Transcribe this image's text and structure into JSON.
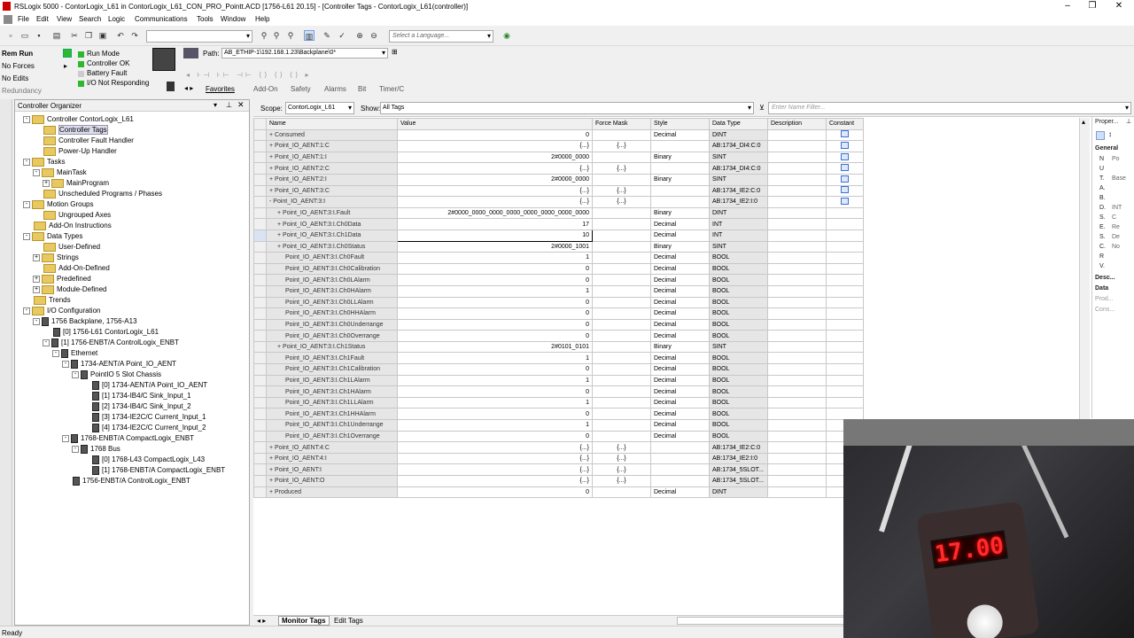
{
  "window": {
    "title": "RSLogix 5000 - ContorLogix_L61 in ContorLogix_L61_CON_PRO_Pointt.ACD [1756-L61 20.15] - [Controller Tags - ContorLogix_L61(controller)]",
    "minimize": "–",
    "restore": "❐",
    "close": "✕"
  },
  "menu": [
    "File",
    "Edit",
    "View",
    "Search",
    "Logic",
    "Communications",
    "Tools",
    "Window",
    "Help"
  ],
  "toolbar": {
    "language_placeholder": "Select a Language...",
    "path_label": "Path:",
    "path_value": "AB_ETHIP-1\\192.168.1.23\\Backplane\\0*"
  },
  "status": {
    "mode": "Rem Run",
    "forces": "No Forces",
    "edits": "No Edits",
    "redundancy": "Redundancy",
    "run_mode": "Run Mode",
    "controller_ok": "Controller OK",
    "battery_fault": "Battery Fault",
    "io_status": "I/O Not Responding"
  },
  "instr_tabs": [
    "Favorites",
    "Add-On",
    "Safety",
    "Alarms",
    "Bit",
    "Timer/C"
  ],
  "organizer": {
    "title": "Controller Organizer",
    "items": [
      {
        "label": "Controller ContorLogix_L61",
        "indent": 1,
        "icon": "folder",
        "exp": "-"
      },
      {
        "label": "Controller Tags",
        "indent": 2,
        "icon": "folder",
        "exp": ""
      },
      {
        "label": "Controller Fault Handler",
        "indent": 2,
        "icon": "folder",
        "exp": ""
      },
      {
        "label": "Power-Up Handler",
        "indent": 2,
        "icon": "folder",
        "exp": ""
      },
      {
        "label": "Tasks",
        "indent": 1,
        "icon": "folder",
        "exp": "-"
      },
      {
        "label": "MainTask",
        "indent": 2,
        "icon": "folder",
        "exp": "-"
      },
      {
        "label": "MainProgram",
        "indent": 3,
        "icon": "folder",
        "exp": "+"
      },
      {
        "label": "Unscheduled Programs / Phases",
        "indent": 2,
        "icon": "folder",
        "exp": ""
      },
      {
        "label": "Motion Groups",
        "indent": 1,
        "icon": "folder",
        "exp": "-"
      },
      {
        "label": "Ungrouped Axes",
        "indent": 2,
        "icon": "folder",
        "exp": ""
      },
      {
        "label": "Add-On Instructions",
        "indent": 1,
        "icon": "folder",
        "exp": ""
      },
      {
        "label": "Data Types",
        "indent": 1,
        "icon": "folder",
        "exp": "-"
      },
      {
        "label": "User-Defined",
        "indent": 2,
        "icon": "folder",
        "exp": ""
      },
      {
        "label": "Strings",
        "indent": 2,
        "icon": "folder",
        "exp": "+"
      },
      {
        "label": "Add-On-Defined",
        "indent": 2,
        "icon": "folder",
        "exp": ""
      },
      {
        "label": "Predefined",
        "indent": 2,
        "icon": "folder",
        "exp": "+"
      },
      {
        "label": "Module-Defined",
        "indent": 2,
        "icon": "folder",
        "exp": "+"
      },
      {
        "label": "Trends",
        "indent": 1,
        "icon": "folder",
        "exp": ""
      },
      {
        "label": "I/O Configuration",
        "indent": 1,
        "icon": "folder",
        "exp": "-"
      },
      {
        "label": "1756 Backplane, 1756-A13",
        "indent": 2,
        "icon": "dev",
        "exp": "-"
      },
      {
        "label": "[0] 1756-L61 ContorLogix_L61",
        "indent": 3,
        "icon": "dev",
        "exp": ""
      },
      {
        "label": "[1] 1756-ENBT/A ControlLogix_ENBT",
        "indent": 3,
        "icon": "dev",
        "exp": "-"
      },
      {
        "label": "Ethernet",
        "indent": 4,
        "icon": "dev",
        "exp": "-"
      },
      {
        "label": "1734-AENT/A Point_IO_AENT",
        "indent": 5,
        "icon": "dev",
        "exp": "-"
      },
      {
        "label": "PointIO 5 Slot Chassis",
        "indent": 6,
        "icon": "dev",
        "exp": "-"
      },
      {
        "label": "[0] 1734-AENT/A Point_IO_AENT",
        "indent": 7,
        "icon": "dev",
        "exp": ""
      },
      {
        "label": "[1] 1734-IB4/C Sink_Input_1",
        "indent": 7,
        "icon": "dev",
        "exp": ""
      },
      {
        "label": "[2] 1734-IB4/C Sink_Input_2",
        "indent": 7,
        "icon": "dev",
        "exp": ""
      },
      {
        "label": "[3] 1734-IE2C/C Current_Input_1",
        "indent": 7,
        "icon": "dev",
        "exp": ""
      },
      {
        "label": "[4] 1734-IE2C/C Current_Input_2",
        "indent": 7,
        "icon": "dev",
        "exp": ""
      },
      {
        "label": "1768-ENBT/A CompactLogix_ENBT",
        "indent": 5,
        "icon": "dev",
        "exp": "-"
      },
      {
        "label": "1768 Bus",
        "indent": 6,
        "icon": "dev",
        "exp": "-"
      },
      {
        "label": "[0] 1768-L43 CompactLogix_L43",
        "indent": 7,
        "icon": "dev",
        "exp": ""
      },
      {
        "label": "[1] 1768-ENBT/A CompactLogix_ENBT",
        "indent": 7,
        "icon": "dev",
        "exp": ""
      },
      {
        "label": "1756-ENBT/A ControlLogix_ENBT",
        "indent": 5,
        "icon": "dev",
        "exp": ""
      }
    ]
  },
  "scope": {
    "scope_label": "Scope:",
    "scope_value": "ContorLogix_L61",
    "show_label": "Show:",
    "show_value": "All Tags",
    "filter_placeholder": "Enter Name Filter..."
  },
  "columns": [
    "Name",
    "Value",
    "Force Mask",
    "Style",
    "Data Type",
    "Description",
    "Constant"
  ],
  "rows": [
    {
      "name": "Consumed",
      "exp": "+",
      "lvl": 0,
      "value": "0",
      "fm": "",
      "style": "Decimal",
      "dt": "DINT",
      "const": true
    },
    {
      "name": "Point_IO_AENT:1:C",
      "exp": "+",
      "lvl": 0,
      "value": "{...}",
      "fm": "{...}",
      "style": "",
      "dt": "AB:1734_DI4:C:0",
      "const": true
    },
    {
      "name": "Point_IO_AENT:1:I",
      "exp": "+",
      "lvl": 0,
      "value": "2#0000_0000",
      "fm": "",
      "style": "Binary",
      "dt": "SINT",
      "const": true
    },
    {
      "name": "Point_IO_AENT:2:C",
      "exp": "+",
      "lvl": 0,
      "value": "{...}",
      "fm": "{...}",
      "style": "",
      "dt": "AB:1734_DI4:C:0",
      "const": true
    },
    {
      "name": "Point_IO_AENT:2:I",
      "exp": "+",
      "lvl": 0,
      "value": "2#0000_0000",
      "fm": "",
      "style": "Binary",
      "dt": "SINT",
      "const": true
    },
    {
      "name": "Point_IO_AENT:3:C",
      "exp": "+",
      "lvl": 0,
      "value": "{...}",
      "fm": "{...}",
      "style": "",
      "dt": "AB:1734_IE2:C:0",
      "const": true
    },
    {
      "name": "Point_IO_AENT:3:I",
      "exp": "-",
      "lvl": 0,
      "value": "{...}",
      "fm": "{...}",
      "style": "",
      "dt": "AB:1734_IE2:I:0",
      "const": true
    },
    {
      "name": "Point_IO_AENT:3:I.Fault",
      "exp": "+",
      "lvl": 1,
      "value": "2#0000_0000_0000_0000_0000_0000_0000_0000",
      "fm": "",
      "style": "Binary",
      "dt": "DINT",
      "const": false
    },
    {
      "name": "Point_IO_AENT:3:I.Ch0Data",
      "exp": "+",
      "lvl": 1,
      "value": "17",
      "fm": "",
      "style": "Decimal",
      "dt": "INT",
      "const": false
    },
    {
      "name": "Point_IO_AENT:3:I.Ch1Data",
      "exp": "+",
      "lvl": 1,
      "value": "10",
      "fm": "",
      "style": "Decimal",
      "dt": "INT",
      "const": false
    },
    {
      "name": "Point_IO_AENT:3:I.Ch0Status",
      "exp": "+",
      "lvl": 1,
      "value": "2#0000_1001",
      "fm": "",
      "style": "Binary",
      "dt": "SINT",
      "const": false
    },
    {
      "name": "Point_IO_AENT:3:I.Ch0Fault",
      "exp": "",
      "lvl": 2,
      "value": "1",
      "fm": "",
      "style": "Decimal",
      "dt": "BOOL",
      "const": false
    },
    {
      "name": "Point_IO_AENT:3:I.Ch0Calibration",
      "exp": "",
      "lvl": 2,
      "value": "0",
      "fm": "",
      "style": "Decimal",
      "dt": "BOOL",
      "const": false
    },
    {
      "name": "Point_IO_AENT:3:I.Ch0LAlarm",
      "exp": "",
      "lvl": 2,
      "value": "0",
      "fm": "",
      "style": "Decimal",
      "dt": "BOOL",
      "const": false
    },
    {
      "name": "Point_IO_AENT:3:I.Ch0HAlarm",
      "exp": "",
      "lvl": 2,
      "value": "1",
      "fm": "",
      "style": "Decimal",
      "dt": "BOOL",
      "const": false
    },
    {
      "name": "Point_IO_AENT:3:I.Ch0LLAlarm",
      "exp": "",
      "lvl": 2,
      "value": "0",
      "fm": "",
      "style": "Decimal",
      "dt": "BOOL",
      "const": false
    },
    {
      "name": "Point_IO_AENT:3:I.Ch0HHAlarm",
      "exp": "",
      "lvl": 2,
      "value": "0",
      "fm": "",
      "style": "Decimal",
      "dt": "BOOL",
      "const": false
    },
    {
      "name": "Point_IO_AENT:3:I.Ch0Underrange",
      "exp": "",
      "lvl": 2,
      "value": "0",
      "fm": "",
      "style": "Decimal",
      "dt": "BOOL",
      "const": false
    },
    {
      "name": "Point_IO_AENT:3:I.Ch0Overrange",
      "exp": "",
      "lvl": 2,
      "value": "0",
      "fm": "",
      "style": "Decimal",
      "dt": "BOOL",
      "const": false
    },
    {
      "name": "Point_IO_AENT:3:I.Ch1Status",
      "exp": "+",
      "lvl": 1,
      "value": "2#0101_0101",
      "fm": "",
      "style": "Binary",
      "dt": "SINT",
      "const": false
    },
    {
      "name": "Point_IO_AENT:3:I.Ch1Fault",
      "exp": "",
      "lvl": 2,
      "value": "1",
      "fm": "",
      "style": "Decimal",
      "dt": "BOOL",
      "const": false
    },
    {
      "name": "Point_IO_AENT:3:I.Ch1Calibration",
      "exp": "",
      "lvl": 2,
      "value": "0",
      "fm": "",
      "style": "Decimal",
      "dt": "BOOL",
      "const": false
    },
    {
      "name": "Point_IO_AENT:3:I.Ch1LAlarm",
      "exp": "",
      "lvl": 2,
      "value": "1",
      "fm": "",
      "style": "Decimal",
      "dt": "BOOL",
      "const": false
    },
    {
      "name": "Point_IO_AENT:3:I.Ch1HAlarm",
      "exp": "",
      "lvl": 2,
      "value": "0",
      "fm": "",
      "style": "Decimal",
      "dt": "BOOL",
      "const": false
    },
    {
      "name": "Point_IO_AENT:3:I.Ch1LLAlarm",
      "exp": "",
      "lvl": 2,
      "value": "1",
      "fm": "",
      "style": "Decimal",
      "dt": "BOOL",
      "const": false
    },
    {
      "name": "Point_IO_AENT:3:I.Ch1HHAlarm",
      "exp": "",
      "lvl": 2,
      "value": "0",
      "fm": "",
      "style": "Decimal",
      "dt": "BOOL",
      "const": false
    },
    {
      "name": "Point_IO_AENT:3:I.Ch1Underrange",
      "exp": "",
      "lvl": 2,
      "value": "1",
      "fm": "",
      "style": "Decimal",
      "dt": "BOOL",
      "const": false
    },
    {
      "name": "Point_IO_AENT:3:I.Ch1Overrange",
      "exp": "",
      "lvl": 2,
      "value": "0",
      "fm": "",
      "style": "Decimal",
      "dt": "BOOL",
      "const": false
    },
    {
      "name": "Point_IO_AENT:4:C",
      "exp": "+",
      "lvl": 0,
      "value": "{...}",
      "fm": "{...}",
      "style": "",
      "dt": "AB:1734_IE2:C:0",
      "const": false
    },
    {
      "name": "Point_IO_AENT:4:I",
      "exp": "+",
      "lvl": 0,
      "value": "{...}",
      "fm": "{...}",
      "style": "",
      "dt": "AB:1734_IE2:I:0",
      "const": false
    },
    {
      "name": "Point_IO_AENT:I",
      "exp": "+",
      "lvl": 0,
      "value": "{...}",
      "fm": "{...}",
      "style": "",
      "dt": "AB:1734_5SLOT...",
      "const": false
    },
    {
      "name": "Point_IO_AENT:O",
      "exp": "+",
      "lvl": 0,
      "value": "{...}",
      "fm": "{...}",
      "style": "",
      "dt": "AB:1734_5SLOT...",
      "const": false
    },
    {
      "name": "Produced",
      "exp": "+",
      "lvl": 0,
      "value": "0",
      "fm": "",
      "style": "Decimal",
      "dt": "DINT",
      "const": false
    }
  ],
  "properties": {
    "title": "Proper...",
    "general": "General",
    "rows": [
      "N",
      "U",
      "T.",
      "A.",
      "B.",
      "D.",
      "S.",
      "E.",
      "S.",
      "C.",
      "R",
      "V."
    ],
    "row_values": [
      "Po",
      "",
      "Base",
      "",
      "",
      "INT",
      "C",
      "Re",
      "De",
      "No",
      "",
      ""
    ],
    "desc": "Desc...",
    "data": "Data",
    "prod": "Prod...",
    "cons": "Cons..."
  },
  "bottom_tabs": [
    "Monitor Tags",
    "Edit Tags"
  ],
  "statusbar": "Ready",
  "meter_reading": "17.00",
  "colors": {
    "led": "#ff2b2b",
    "accent": "#3a6fd8"
  }
}
